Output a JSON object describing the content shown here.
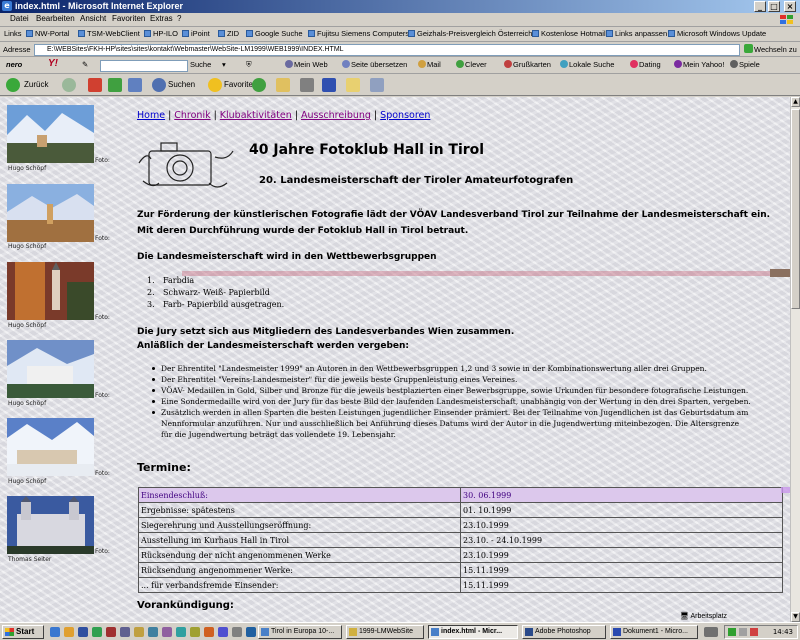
{
  "window": {
    "title": "index.html - Microsoft Internet Explorer"
  },
  "menu": [
    "Datei",
    "Bearbeiten",
    "Ansicht",
    "Favoriten",
    "Extras",
    "?"
  ],
  "links_bar": {
    "label": "Links",
    "items": [
      "NW-Portal",
      "TSM-WebClient",
      "HP-ILO",
      "iPoint",
      "ZID",
      "Google Suche",
      "Fujitsu Siemens Computers",
      "Geizhals-Preisvergleich Österreich",
      "Kostenlose Hotmail",
      "Links anpassen",
      "Microsoft Windows Update"
    ]
  },
  "address_bar": {
    "label": "Adresse",
    "url": "E:\\WEBSites\\FKH-HP\\sites\\sites\\kontakt\\Webmaster\\WebSite-LM1999\\WEB1999\\INDEX.HTML",
    "go_label": "Wechseln zu"
  },
  "nero_bar": {
    "nero": "nero",
    "yahoo": "Y!",
    "search_label": "Suche",
    "items": [
      "Mein Web",
      "Seite übersetzen",
      "Mail",
      "Clever",
      "Grußkarten",
      "Lokale Suche",
      "Dating",
      "Mein Yahoo!",
      "Spiele"
    ]
  },
  "std_toolbar": {
    "back": "Zurück",
    "search": "Suchen",
    "favorites": "Favoriten"
  },
  "photos": [
    {
      "credit": "Hugo Schöpf",
      "foto": "Foto:"
    },
    {
      "credit": "Hugo Schöpf",
      "foto": "Foto:"
    },
    {
      "credit": "Hugo Schöpf",
      "foto": "Foto:"
    },
    {
      "credit": "Hugo Schöpf",
      "foto": "Foto:"
    },
    {
      "credit": "Hugo Schöpf",
      "foto": "Foto:"
    },
    {
      "credit": "Thomas Seiter",
      "foto": "Foto:"
    }
  ],
  "nav": [
    "Home",
    "Chronik",
    "Klubaktivitäten",
    "Ausschreibung",
    "Sponsoren"
  ],
  "heading": "40 Jahre Fotoklub Hall in Tirol",
  "subheading": "20. Landesmeisterschaft der Tiroler Amateurfotografen",
  "intro": "Zur Förderung der künstlerischen Fotografie lädt der VÖAV Landesverband Tirol zur Teilnahme der Landesmeisterschaft ein. Mit deren Durchführung wurde der Fotoklub Hall in Tirol betraut.",
  "groups_heading": "Die Landesmeisterschaft wird in den Wettbewerbsgruppen",
  "groups": [
    {
      "n": "1.",
      "text": "Farbdia"
    },
    {
      "n": "2.",
      "text": "Schwarz- Weiß- Papierbild"
    },
    {
      "n": "3.",
      "text": "Farb- Papierbild ausgetragen."
    }
  ],
  "jury_line1": "Die Jury setzt sich aus Mitgliedern des Landesverbandes Wien zusammen.",
  "jury_line2": "Anläßlich der Landesmeisterschaft werden vergeben:",
  "awards": [
    "Der Ehrentitel \"Landesmeister 1999\" an Autoren in den Wettbewerbsgruppen 1,2 und 3 sowie in der Kombinationswertung aller drei Gruppen.",
    "Der Ehrentitel \"Vereins-Landesmeister\" für die jeweils beste Gruppenleistung eines Vereines.",
    "VÖAV- Medaillen in Gold, Silber und Bronze für die jeweils bestplazierten einer Bewerbsgruppe, sowie Urkunden für besondere fotografische Leistungen.",
    "Eine Sondermedaille wird von der Jury für das beste Bild der laufenden Landesmeisterschaft, unabhängig von der Wertung in den drei Sparten, vergeben.",
    "Zusätzlich werden in allen Sparten die besten Leistungen jugendlicher Einsender prämiert. Bei der Teilnahme von Jugendlichen ist das Geburtsdatum am Nennformular anzuführen. Nur und ausschließlich bei Anführung dieses Datums wird der Autor in die Jugendwertung miteinbezogen. Die Altersgrenze für die Jugendwertung beträgt das vollendete 19. Lebensjahr."
  ],
  "termine_heading": "Termine:",
  "termine": [
    {
      "label": "Einsendeschluß:",
      "date": "30. 06.1999"
    },
    {
      "label": "Ergebnisse: spätestens",
      "date": "01. 10.1999"
    },
    {
      "label": "Siegerehrung und Ausstellungseröffnung:",
      "date": "23.10.1999"
    },
    {
      "label": "Ausstellung im Kurhaus Hall in Tirol",
      "date": "23.10. - 24.10.1999"
    },
    {
      "label": "Rücksendung der nicht angenommenen Werke",
      "date": "23.10.1999"
    },
    {
      "label": "Rücksendung angenommener Werke:",
      "date": "15.11.1999"
    },
    {
      "label": "... für verbandsfremde Einsender:",
      "date": "15.11.1999"
    }
  ],
  "vorankundigung": "Vorankündigung:",
  "status": {
    "zone": "Arbeitsplatz"
  },
  "taskbar": {
    "start": "Start",
    "tasks": [
      "Tirol in Europa 10-...",
      "1999-LMWebSite",
      "index.html - Micr...",
      "Adobe Photoshop",
      "Dokument1 - Micro..."
    ],
    "clock": "14:43"
  }
}
